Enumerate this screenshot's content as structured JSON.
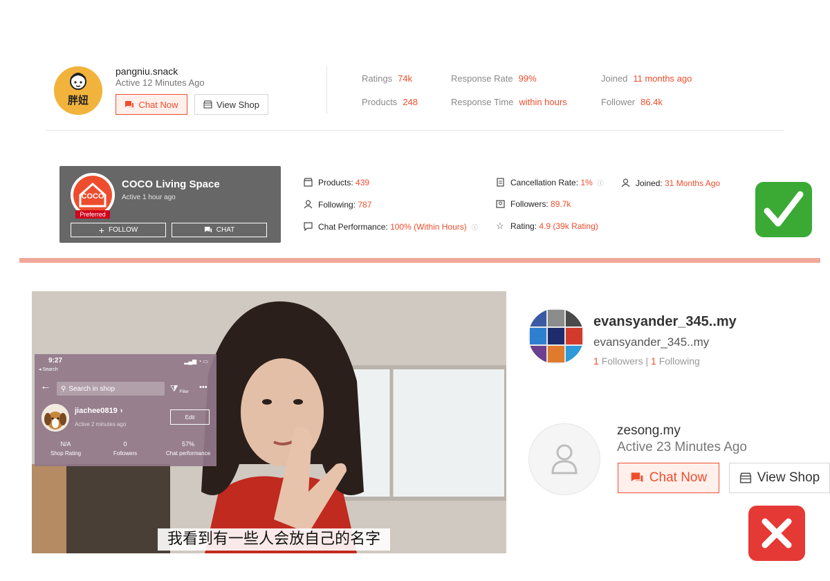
{
  "colors": {
    "accent": "#ee4d2d",
    "card_bg": "#676767",
    "divider": "#f2a899",
    "check_green": "#3aaa35",
    "cross_red": "#e53935"
  },
  "pangniu": {
    "logo_text": "胖妞",
    "name": "pangniu.snack",
    "active": "Active 12 Minutes Ago",
    "chat_label": "Chat Now",
    "view_label": "View Shop",
    "stats": {
      "ratings_label": "Ratings",
      "ratings_value": "74k",
      "products_label": "Products",
      "products_value": "248",
      "response_rate_label": "Response Rate",
      "response_rate_value": "99%",
      "response_time_label": "Response Time",
      "response_time_value": "within hours",
      "joined_label": "Joined",
      "joined_value": "11 months ago",
      "follower_label": "Follower",
      "follower_value": "86.4k"
    }
  },
  "coco": {
    "logo_text": "COCO",
    "badge": "Preferred",
    "name": "COCO Living Space",
    "active": "Active 1 hour ago",
    "follow_label": "FOLLOW",
    "chat_label": "CHAT",
    "stats": {
      "products_label": "Products:",
      "products_value": "439",
      "following_label": "Following:",
      "following_value": "787",
      "chat_perf_label": "Chat Performance:",
      "chat_perf_value": "100% (Within Hours)",
      "cancel_label": "Cancellation Rate:",
      "cancel_value": "1%",
      "followers_label": "Followers:",
      "followers_value": "89.7k",
      "rating_label": "Rating:",
      "rating_value": "4.9 (39k Rating)",
      "joined_label": "Joined:",
      "joined_value": "31 Months Ago"
    }
  },
  "video": {
    "phone": {
      "time": "9:27",
      "back_label": "◂ Search",
      "search_placeholder": "Search in shop",
      "filter_label": "Filter",
      "username": "jiachee0819",
      "active": "Active 2 minutes ago",
      "edit_label": "Edit",
      "rating_value": "N/A",
      "rating_label": "Shop Rating",
      "followers_value": "0",
      "followers_label": "Followers",
      "chat_value": "57%",
      "chat_label": "Chat performance"
    },
    "subtitle": "我看到有一些人会放自己的名字"
  },
  "evan": {
    "name": "evansyander_345..my",
    "username": "evansyander_345..my",
    "followers_count": "1",
    "followers_label": "Followers",
    "separator": "|",
    "following_count": "1",
    "following_label": "Following"
  },
  "zesong": {
    "name": "zesong.my",
    "active": "Active 23 Minutes Ago",
    "chat_label": "Chat Now",
    "view_label": "View Shop"
  },
  "icons": [
    "chat-icon",
    "shop-icon",
    "plus-icon",
    "check-icon",
    "cross-icon",
    "user-icon",
    "star-icon",
    "store-icon",
    "clock-icon"
  ]
}
